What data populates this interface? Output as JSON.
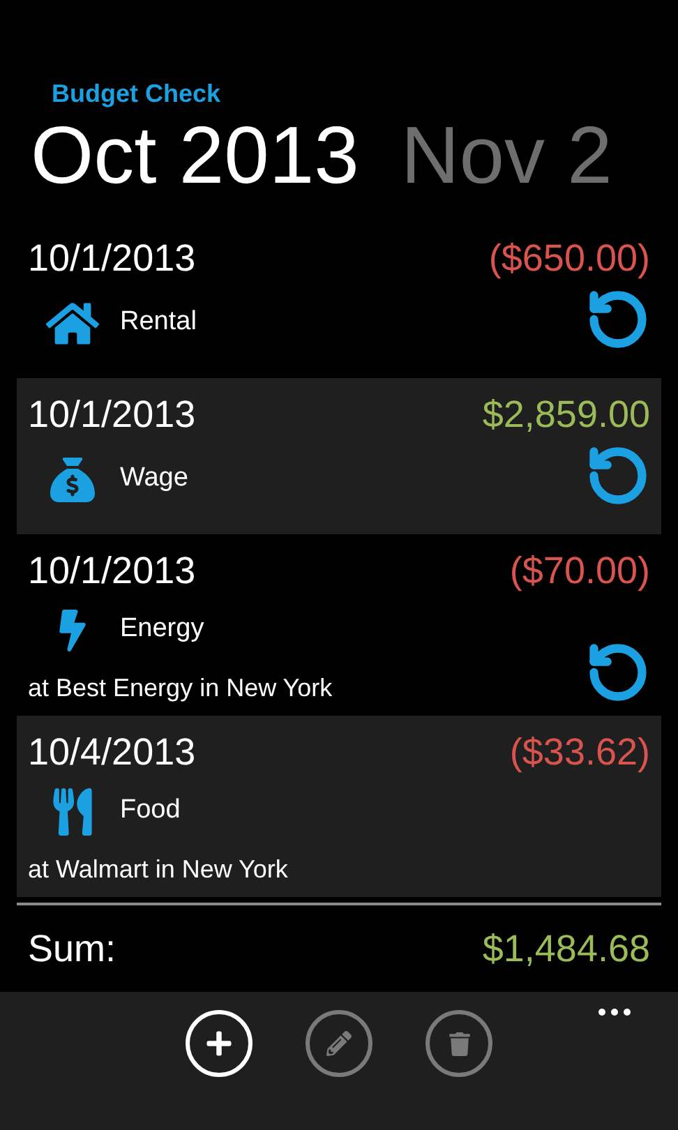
{
  "app_title": "Budget Check",
  "pivot": [
    {
      "label": "Oct 2013",
      "selected": true
    },
    {
      "label": "Nov 2",
      "selected": false
    }
  ],
  "transactions": [
    {
      "date": "10/1/2013",
      "amount": "($650.00)",
      "negative": true,
      "category": "Rental",
      "kind": "house",
      "recurring": true
    },
    {
      "date": "10/1/2013",
      "amount": "$2,859.00",
      "negative": false,
      "category": "Wage",
      "kind": "money",
      "recurring": true
    },
    {
      "date": "10/1/2013",
      "amount": "($70.00)",
      "negative": true,
      "category": "Energy",
      "kind": "bolt",
      "location": "at Best Energy in New York",
      "recurring": true
    },
    {
      "date": "10/4/2013",
      "amount": "($33.62)",
      "negative": true,
      "category": "Food",
      "kind": "food",
      "location": "at Walmart in New York",
      "recurring": false
    }
  ],
  "sum": {
    "label": "Sum:",
    "amount": "$1,484.68",
    "negative": false
  },
  "app_bar": [
    {
      "kind": "add",
      "disabled": false
    },
    {
      "kind": "edit",
      "disabled": true
    },
    {
      "kind": "delete",
      "disabled": true
    }
  ]
}
